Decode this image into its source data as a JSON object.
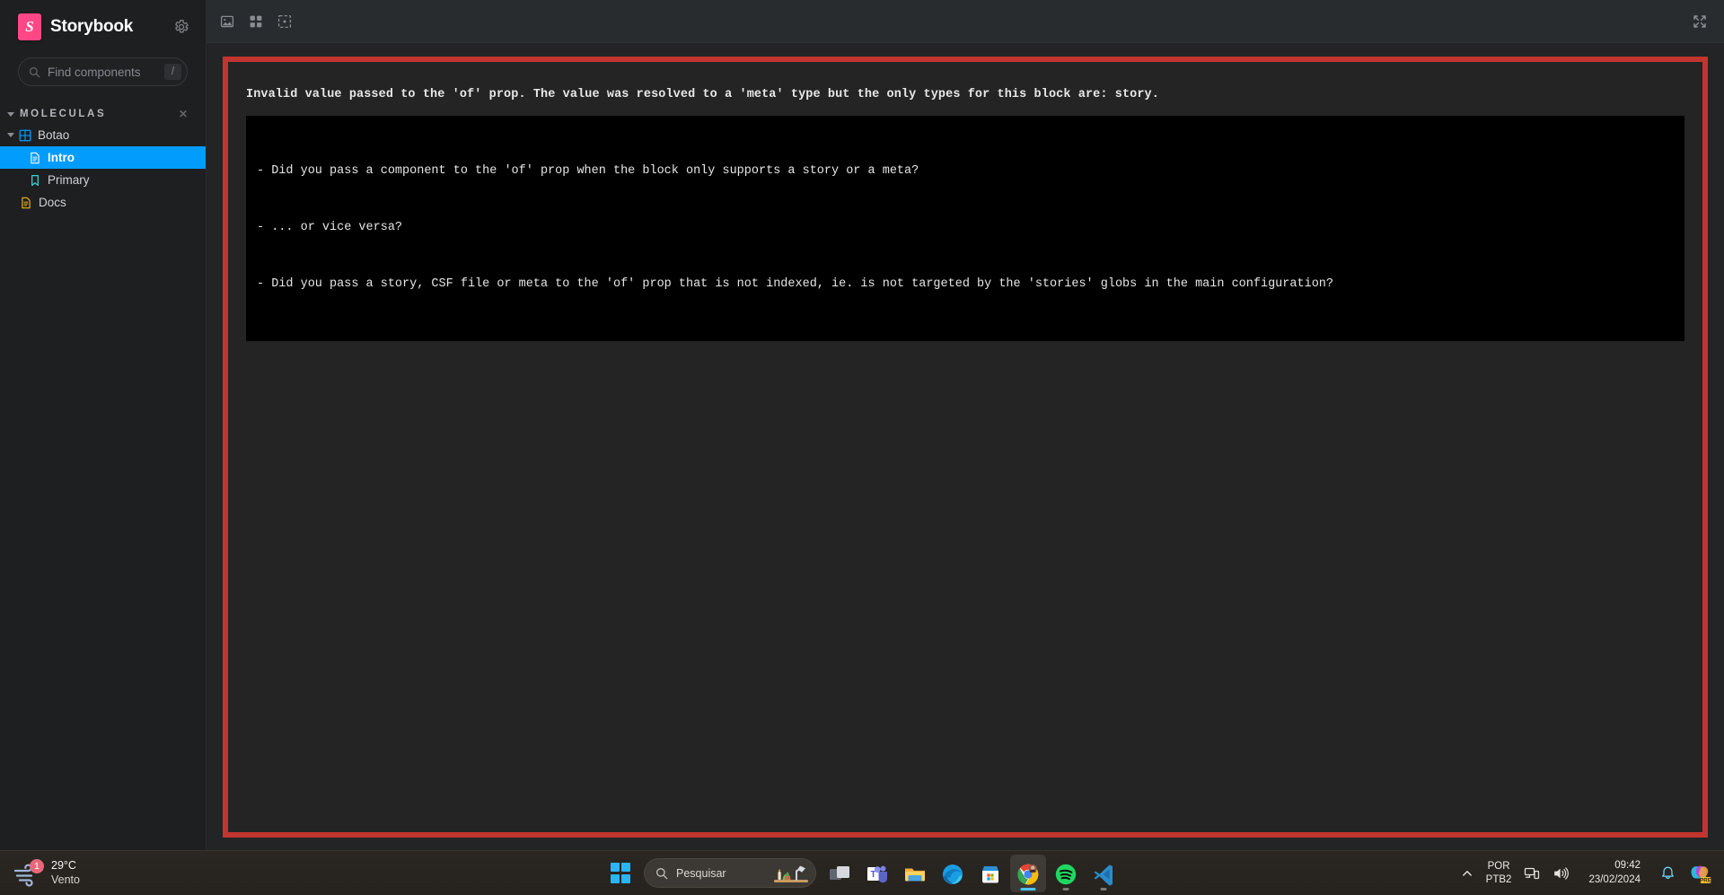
{
  "sidebar": {
    "brand": {
      "logo_letter": "S",
      "title": "Storybook",
      "accent": "#ff4785"
    },
    "settings_icon": "gear-icon",
    "search": {
      "placeholder": "Find components",
      "shortcut": "/",
      "icon": "search-icon"
    },
    "group": {
      "label": "MOLECULAS",
      "expand_icon": "caret-down-icon",
      "collapse_all_icon": "collapse-all-icon"
    },
    "items": [
      {
        "label": "Botao",
        "depth": 1,
        "icon": "component-icon",
        "icon_color": "#029cfd",
        "selected": false,
        "expanded": true
      },
      {
        "label": "Intro",
        "depth": 2,
        "icon": "document-icon",
        "icon_color": "#ffffff",
        "selected": true,
        "expanded": false
      },
      {
        "label": "Primary",
        "depth": 2,
        "icon": "story-icon",
        "icon_color": "#37d5d3",
        "selected": false,
        "expanded": false
      },
      {
        "label": "Docs",
        "depth": 1,
        "icon": "docs-icon",
        "icon_color": "#f1b31c",
        "selected": false,
        "expanded": false
      }
    ],
    "selected_color": "#029cfd"
  },
  "toolbar": {
    "buttons": [
      {
        "name": "zoom-reset-icon",
        "title": "Reset zoom"
      },
      {
        "name": "grid-icon",
        "title": "Apply a grid to the preview"
      },
      {
        "name": "measure-icon",
        "title": "Enable measure"
      }
    ],
    "fullscreen_icon": "fullscreen-icon"
  },
  "error": {
    "border_color": "#c2352f",
    "background": "#242424",
    "pre_background": "#000000",
    "headline": "Invalid value passed to the 'of' prop. The value was resolved to a 'meta' type but the only types for this block are: story.",
    "hints": [
      "- Did you pass a component to the 'of' prop when the block only supports a story or a meta?",
      "- ... or vice versa?",
      "- Did you pass a story, CSF file or meta to the 'of' prop that is not indexed, ie. is not targeted by the 'stories' globs in the main configuration?"
    ]
  },
  "taskbar": {
    "weather": {
      "temperature": "29°C",
      "condition": "Vento",
      "badge": "1",
      "icon": "wind-icon"
    },
    "start": {
      "icon": "windows-logo-icon",
      "label": "Iniciar"
    },
    "search": {
      "placeholder": "Pesquisar",
      "icon": "search-icon"
    },
    "apps": [
      {
        "name": "task-view-icon",
        "label": "Visão de tarefas",
        "running": false,
        "active": false
      },
      {
        "name": "microsoft-teams-icon",
        "label": "Microsoft Teams",
        "running": false,
        "active": false
      },
      {
        "name": "file-explorer-icon",
        "label": "Explorador de Arquivos",
        "running": false,
        "active": false
      },
      {
        "name": "microsoft-edge-icon",
        "label": "Microsoft Edge",
        "running": false,
        "active": false
      },
      {
        "name": "microsoft-store-icon",
        "label": "Microsoft Store",
        "running": false,
        "active": false
      },
      {
        "name": "google-chrome-icon",
        "label": "Google Chrome",
        "running": true,
        "active": true
      },
      {
        "name": "spotify-icon",
        "label": "Spotify",
        "running": true,
        "active": false
      },
      {
        "name": "visual-studio-code-icon",
        "label": "Visual Studio Code",
        "running": true,
        "active": false
      }
    ],
    "tray": {
      "overflow_icon": "chevron-up-icon",
      "language_line1": "POR",
      "language_line2": "PTB2",
      "network_icon": "network-icon",
      "volume_icon": "volume-icon",
      "time": "09:42",
      "date": "23/02/2024",
      "notification_icon": "bell-icon",
      "copilot_icon": "copilot-icon",
      "copilot_badge": "PRE"
    }
  }
}
